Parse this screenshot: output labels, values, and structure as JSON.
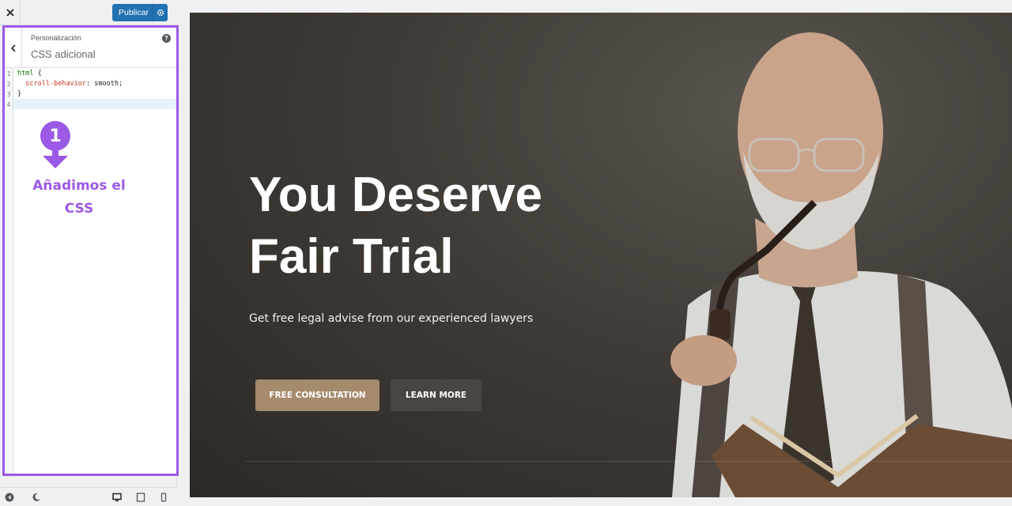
{
  "topbar": {
    "publish_label": "Publicar"
  },
  "panel": {
    "breadcrumb": "Personalización",
    "title": "CSS adicional",
    "help_glyph": "?"
  },
  "editor": {
    "lines": [
      {
        "number": "1",
        "text": "html {"
      },
      {
        "number": "2",
        "text": "  scroll-behavior: smooth;"
      },
      {
        "number": "3",
        "text": "}"
      },
      {
        "number": "4",
        "text": ""
      }
    ],
    "tokens": {
      "selector": "html",
      "property": "scroll-behavior",
      "value": ": smooth;"
    }
  },
  "annotation": {
    "step": "1",
    "line1": "Añadimos el",
    "line2": "CSS",
    "color": "#9b59e6"
  },
  "preview": {
    "title_line1": "You Deserve",
    "title_line2": "Fair Trial",
    "subtitle": "Get free legal advise from our experienced lawyers",
    "primary_button": "FREE CONSULTATION",
    "secondary_button": "LEARN MORE",
    "primary_color": "#a58a6e"
  },
  "icons": {
    "close": "close-icon",
    "back": "chevron-left-icon",
    "gear": "gear-icon",
    "help": "help-icon",
    "footer": [
      "collapse-icon",
      "dark-mode-icon",
      "desktop-icon",
      "tablet-icon",
      "mobile-icon"
    ]
  }
}
